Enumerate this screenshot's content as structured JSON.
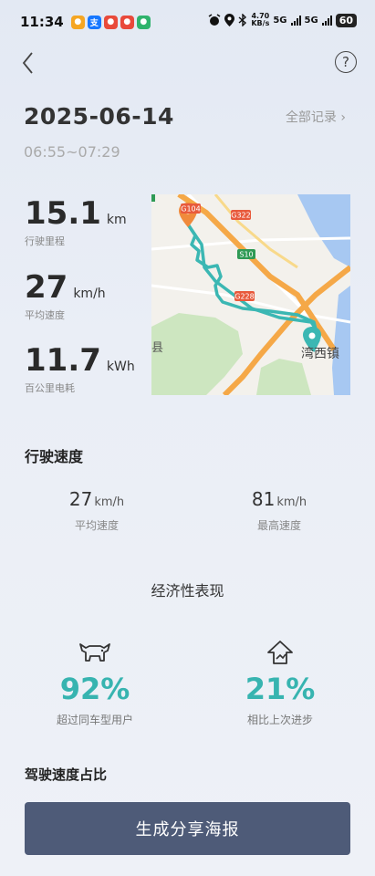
{
  "status_bar": {
    "time": "11:34",
    "net_speed_value": "4.70",
    "net_speed_unit": "KB/s",
    "sim1": "5G",
    "sim2": "5G",
    "battery": "60"
  },
  "header": {
    "date": "2025-06-14",
    "all_records_label": "全部记录 ›",
    "time_range": "06:55~07:29"
  },
  "stats": [
    {
      "value": "15.1",
      "unit": "km",
      "label": "行驶里程"
    },
    {
      "value": "27",
      "unit": "km/h",
      "label": "平均速度"
    },
    {
      "value": "11.7",
      "unit": "kWh",
      "label": "百公里电耗"
    }
  ],
  "map": {
    "road_labels": [
      "G104",
      "G322",
      "S10",
      "G228"
    ],
    "place_labels": [
      "县",
      "湾西镇"
    ],
    "colors": {
      "route": "#3bb7b3",
      "highway": "#f5a847",
      "water": "#a7c8f2",
      "green": "#cde6c0"
    }
  },
  "driving_speed": {
    "title": "行驶速度",
    "avg": {
      "value": "27",
      "unit": "km/h",
      "label": "平均速度"
    },
    "max": {
      "value": "81",
      "unit": "km/h",
      "label": "最高速度"
    }
  },
  "economy": {
    "title": "经济性表现",
    "items": [
      {
        "icon": "bull-icon",
        "percent": "92%",
        "label": "超过同车型用户"
      },
      {
        "icon": "progress-arrow-icon",
        "percent": "21%",
        "label": "相比上次进步"
      }
    ],
    "accent": "#37b4b0"
  },
  "speed_ratio_title": "驾驶速度占比",
  "share_button_label": "生成分享海报"
}
